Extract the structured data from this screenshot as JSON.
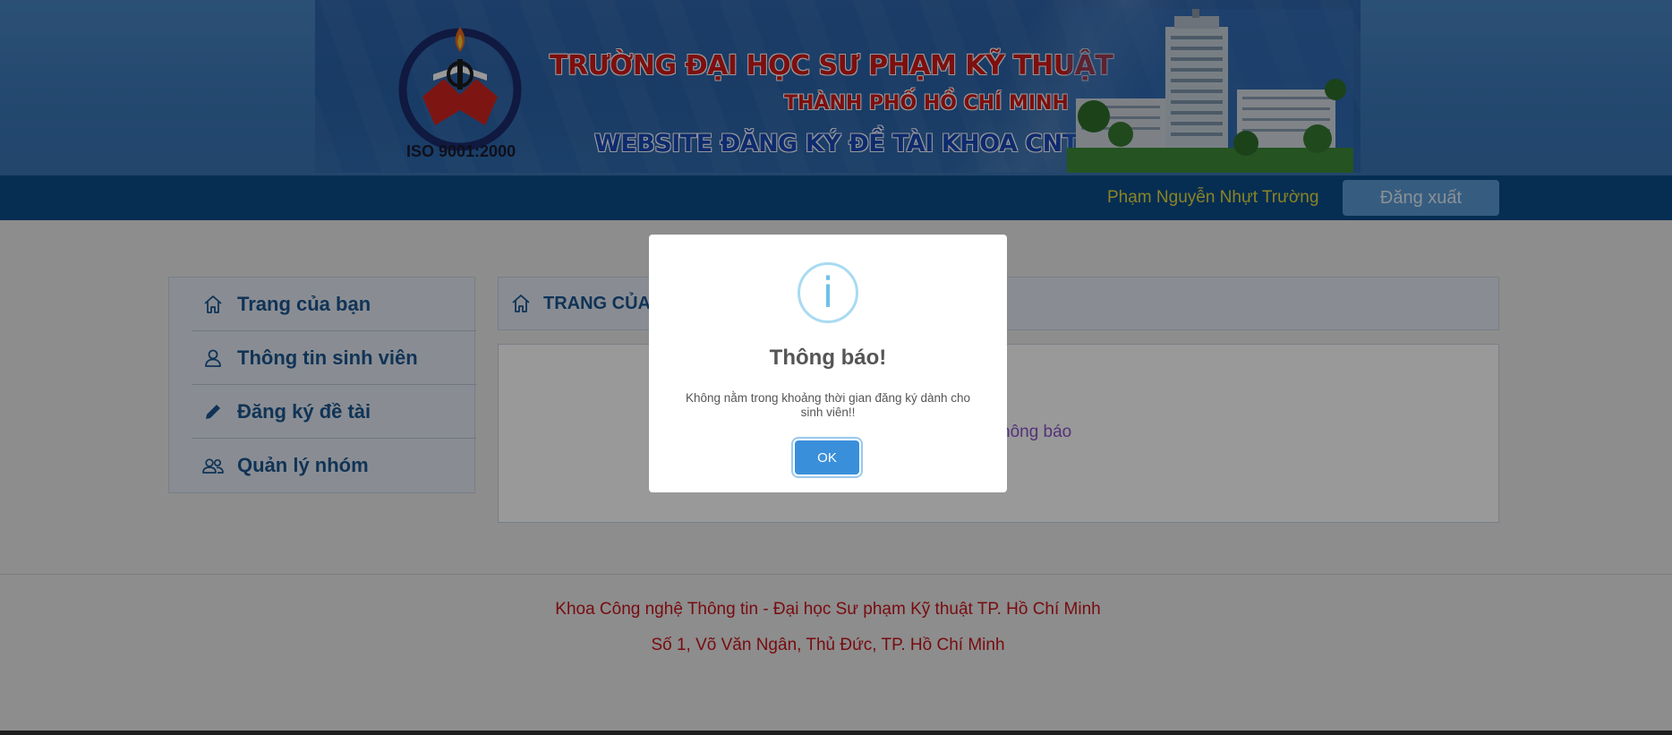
{
  "header": {
    "banner_title_1": "TRƯỜNG ĐẠI HỌC SƯ PHẠM KỸ THUẬT",
    "banner_title_2": "THÀNH PHỐ HỒ CHÍ MINH",
    "banner_title_3": "WEBSITE ĐĂNG KÝ ĐỀ TÀI KHOA CNTT",
    "iso": "ISO 9001:2000"
  },
  "navbar": {
    "user_name": "Phạm Nguyễn Nhựt Trường",
    "logout_label": "Đăng xuất"
  },
  "sidebar": {
    "items": [
      {
        "label": "Trang của bạn",
        "icon": "home-icon"
      },
      {
        "label": "Thông tin sinh viên",
        "icon": "user-icon"
      },
      {
        "label": "Đăng ký đề tài",
        "icon": "pencil-icon"
      },
      {
        "label": "Quản lý nhóm",
        "icon": "group-icon"
      }
    ]
  },
  "main": {
    "title": "TRANG CỦA",
    "note": "hông báo"
  },
  "footer": {
    "line_1": "Khoa Công nghệ Thông tin - Đại học Sư phạm Kỹ thuật TP. Hồ Chí Minh",
    "line_2": "Số 1, Võ Văn Ngân, Thủ Đức, TP. Hồ Chí Minh"
  },
  "modal": {
    "icon_glyph": "i",
    "title": "Thông báo!",
    "message": "Không nằm trong khoảng thời gian đăng ký dành cho sinh viên!!",
    "ok_label": "OK"
  },
  "colors": {
    "navbar": "#0b4d8a",
    "sidebar_text": "#1c5690",
    "footer_text": "#c8141c",
    "user_name": "#e8dc3c",
    "ok_button": "#3a8fdb"
  }
}
